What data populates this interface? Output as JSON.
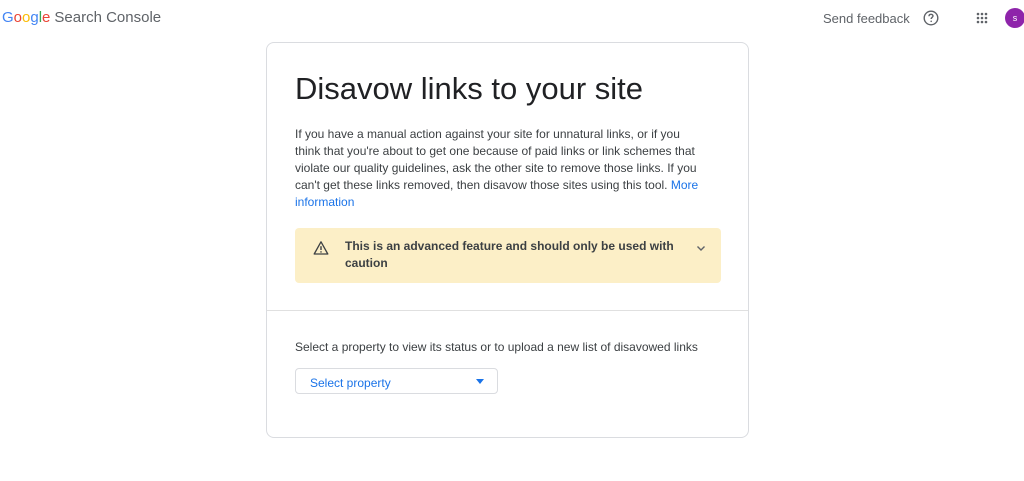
{
  "header": {
    "logo_letters": [
      "G",
      "o",
      "o",
      "g",
      "l",
      "e"
    ],
    "product_name": "Search Console",
    "feedback_label": "Send feedback",
    "avatar_initial": "s"
  },
  "page": {
    "title": "Disavow links to your site",
    "intro_text": "If you have a manual action against your site for unnatural links, or if you think that you're about to get one because of paid links or link schemes that violate our quality guidelines, ask the other site to remove those links. If you can't get these links removed, then disavow those sites using this tool.",
    "more_info_link": "More information",
    "warning_text": "This is an advanced feature and should only be used with caution",
    "select_label": "Select a property to view its status or to upload a new list of disavowed links",
    "select_placeholder": "Select property"
  },
  "colors": {
    "brand_blue": "#1a73e8",
    "warning_bg": "#fcefc7",
    "avatar_bg": "#8e24aa"
  },
  "icons": {
    "help": "help-circle-icon",
    "apps": "apps-grid-icon",
    "warning": "warning-triangle-icon",
    "chevron": "chevron-down-icon",
    "dropdown": "dropdown-arrow-icon"
  }
}
